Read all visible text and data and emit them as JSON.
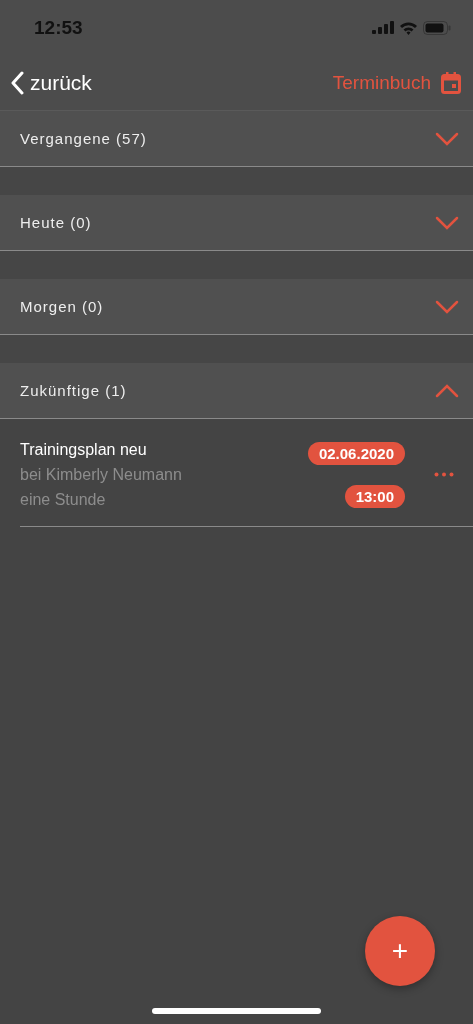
{
  "status_bar": {
    "time": "12:53"
  },
  "nav": {
    "back_label": "zurück",
    "title": "Terminbuch"
  },
  "sections": [
    {
      "title": "Vergangene (57)",
      "expanded": false
    },
    {
      "title": "Heute (0)",
      "expanded": false
    },
    {
      "title": "Morgen (0)",
      "expanded": false
    },
    {
      "title": "Zukünftige (1)",
      "expanded": true,
      "appointments": [
        {
          "title": "Trainingsplan neu",
          "with": "bei Kimberly Neumann",
          "duration": "eine Stunde",
          "date": "02.06.2020",
          "time": "13:00"
        }
      ]
    }
  ],
  "fab": {
    "label": "+"
  }
}
